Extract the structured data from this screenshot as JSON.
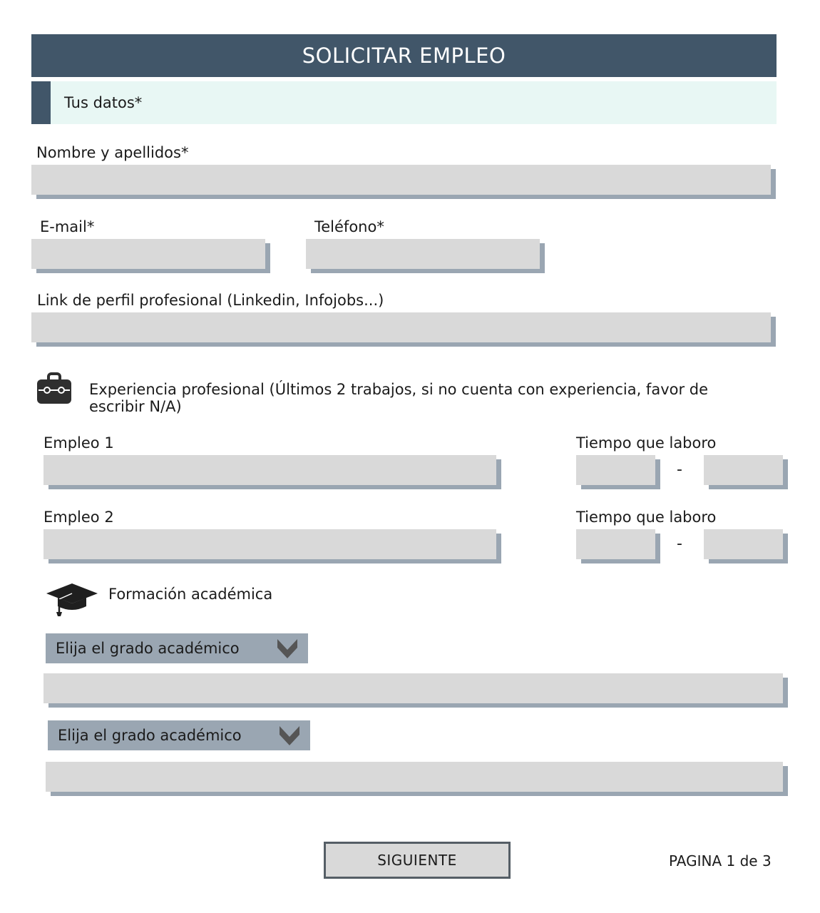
{
  "header": {
    "title": "SOLICITAR EMPLEO"
  },
  "personal": {
    "section_title": "Tus datos*",
    "fullname_label": "Nombre y apellidos*",
    "fullname_value": "",
    "email_label": "E-mail*",
    "email_value": "",
    "phone_label": "Teléfono*",
    "phone_value": "",
    "profile_label": "Link de perfil profesional (Linkedin, Infojobs...)",
    "profile_value": ""
  },
  "experience": {
    "icon": "briefcase-icon",
    "heading_line1": "Experiencia profesional (Últimos 2 trabajos, si no cuenta con experiencia, favor de",
    "heading_line2": "escribir N/A)",
    "jobs": [
      {
        "label": "Empleo 1",
        "time_label": "Tiempo que laboro",
        "separator": "-"
      },
      {
        "label": "Empleo 2",
        "time_label": "Tiempo que laboro",
        "separator": "-"
      }
    ]
  },
  "education": {
    "icon": "graduation-cap-icon",
    "heading": "Formación académica",
    "selects": [
      {
        "selected": "Elija el grado académico"
      },
      {
        "selected": "Elija el grado académico"
      }
    ]
  },
  "footer": {
    "next_label": "SIGUIENTE",
    "page_indicator": "PAGINA  1 de 3"
  },
  "colors": {
    "header_bg": "#415669",
    "section_bg": "#e8f7f4",
    "field_bg": "#d9d9d9",
    "field_shadow": "#9aa6b2",
    "select_bg": "#9aa6b2",
    "chevron": "#555555"
  }
}
